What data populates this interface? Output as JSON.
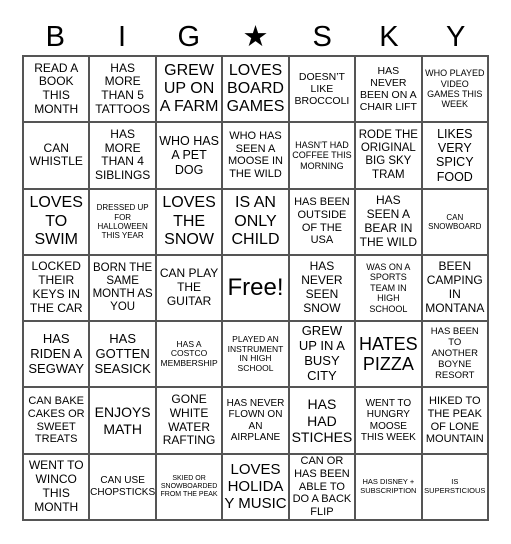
{
  "header": {
    "letters": [
      "B",
      "I",
      "G",
      "★",
      "S",
      "K",
      "Y"
    ]
  },
  "cells": [
    [
      "READ A BOOK THIS MONTH",
      "HAS MORE THAN 5 TATTOOS",
      "GREW UP ON A FARM",
      "LOVES BOARD GAMES",
      "DOESN’T LIKE BROCCOLI",
      "HAS NEVER BEEN ON A CHAIR LIFT",
      "WHO PLAYED VIDEO GAMES THIS WEEK"
    ],
    [
      "CAN WHISTLE",
      "HAS MORE THAN 4 SIBLINGS",
      "WHO HAS A PET DOG",
      "WHO HAS SEEN A MOOSE IN THE WILD",
      "HASN'T HAD COFFEE THIS MORNING",
      "RODE THE ORIGINAL BIG SKY TRAM",
      "LIKES VERY SPICY FOOD"
    ],
    [
      "LOVES TO SWIM",
      "DRESSED UP FOR HALLOWEEN THIS YEAR",
      "LOVES THE SNOW",
      "IS AN ONLY CHILD",
      "HAS BEEN OUTSIDE OF THE USA",
      "HAS SEEN A BEAR IN THE WILD",
      "CAN SNOWBOARD"
    ],
    [
      "LOCKED THEIR KEYS IN THE CAR",
      "BORN THE SAME MONTH AS YOU",
      "CAN PLAY THE GUITAR",
      "Free!",
      "HAS NEVER SEEN SNOW",
      "WAS ON A SPORTS TEAM IN HIGH SCHOOL",
      "BEEN CAMPING IN MONTANA"
    ],
    [
      "HAS RIDEN A SEGWAY",
      "HAS GOTTEN SEASICK",
      "HAS A COSTCO MEMBERSHIP",
      "PLAYED AN INSTRUMENT IN HIGH SCHOOL",
      "GREW UP IN A BUSY CITY",
      "HATES PIZZA",
      "HAS BEEN TO ANOTHER BOYNE RESORT"
    ],
    [
      "CAN BAKE CAKES OR SWEET TREATS",
      "ENJOYS MATH",
      "GONE WHITE WATER RAFTING",
      "HAS NEVER FLOWN ON AN AIRPLANE",
      "HAS HAD STICHES",
      "WENT TO HUNGRY MOOSE THIS WEEK",
      "HIKED TO THE PEAK OF LONE MOUNTAIN"
    ],
    [
      "WENT TO WINCO THIS MONTH",
      "CAN USE CHOPSTICKS",
      "SKIED OR SNOWBOARDED FROM THE PEAK",
      "LOVES HOLIDAY MUSIC",
      "CAN OR HAS BEEN ABLE TO DO A BACK FLIP",
      "HAS DISNEY + SUBSCRIPTION",
      "IS SUPERSTICIOUS"
    ]
  ]
}
